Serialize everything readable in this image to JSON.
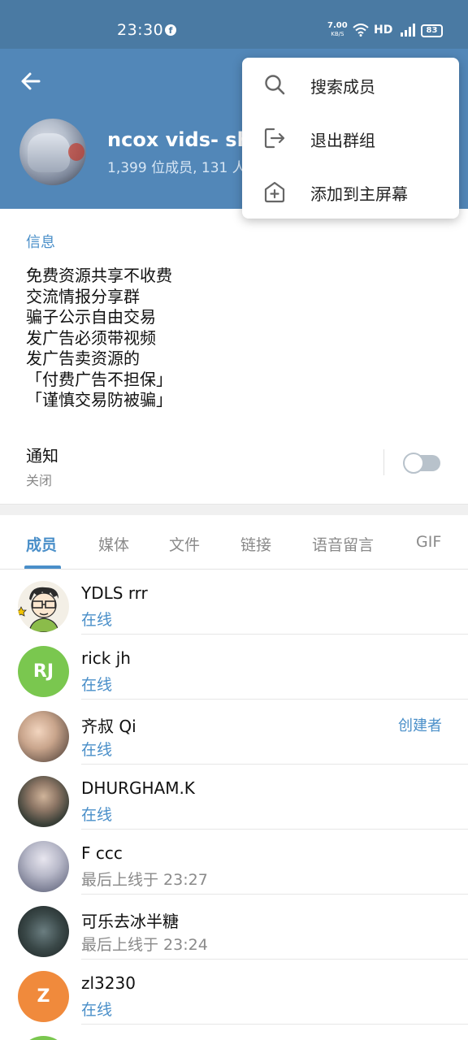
{
  "status_bar": {
    "time": "23:30",
    "net_speed": "7.00",
    "net_unit": "KB/S",
    "hd": "HD",
    "battery": "83"
  },
  "header": {
    "title": "ncox vids- sha",
    "subtitle": "1,399 位成员, 131 人"
  },
  "menu": {
    "items": [
      {
        "label": "搜索成员",
        "icon": "search-icon"
      },
      {
        "label": "退出群组",
        "icon": "leave-icon"
      },
      {
        "label": "添加到主屏幕",
        "icon": "add-home-icon"
      }
    ]
  },
  "info": {
    "section_title": "信息",
    "description_lines": [
      "免费资源共享不收费",
      "交流情报分享群",
      "骗子公示自由交易",
      "发广告必须带视频",
      "发广告卖资源的",
      "「付费广告不担保」",
      "「谨慎交易防被骗」"
    ],
    "notifications_label": "通知",
    "notifications_status": "关闭",
    "notifications_enabled": false
  },
  "tabs": [
    "成员",
    "媒体",
    "文件",
    "链接",
    "语音留言",
    "GIF"
  ],
  "active_tab": 0,
  "members": [
    {
      "name": "YDLS rrr",
      "status": "在线",
      "online": true,
      "initials": "",
      "color": "#f3efe6"
    },
    {
      "name": "rick jh",
      "status": "在线",
      "online": true,
      "initials": "RJ",
      "color": "#7ac74f"
    },
    {
      "name": "齐叔 Qi",
      "status": "在线",
      "online": true,
      "initials": "",
      "color": "#c9a58c",
      "role": "创建者"
    },
    {
      "name": "DHURGHAM.K",
      "status": "在线",
      "online": true,
      "initials": "",
      "color": "#5d6a5a"
    },
    {
      "name": "F ccc",
      "status": "最后上线于 23:27",
      "online": false,
      "initials": "",
      "color": "#9da3b4"
    },
    {
      "name": "可乐去冰半糖",
      "status": "最后上线于 23:24",
      "online": false,
      "initials": "",
      "color": "#2f3a3a"
    },
    {
      "name": "zl3230",
      "status": "在线",
      "online": true,
      "initials": "Z",
      "color": "#f08a3c"
    },
    {
      "name": "",
      "status": "",
      "online": true,
      "initials": "",
      "color": "#7ac74f"
    }
  ],
  "colors": {
    "header": "#5287b8",
    "status_bar": "#4a7aa3",
    "accent": "#4a8fc9"
  }
}
